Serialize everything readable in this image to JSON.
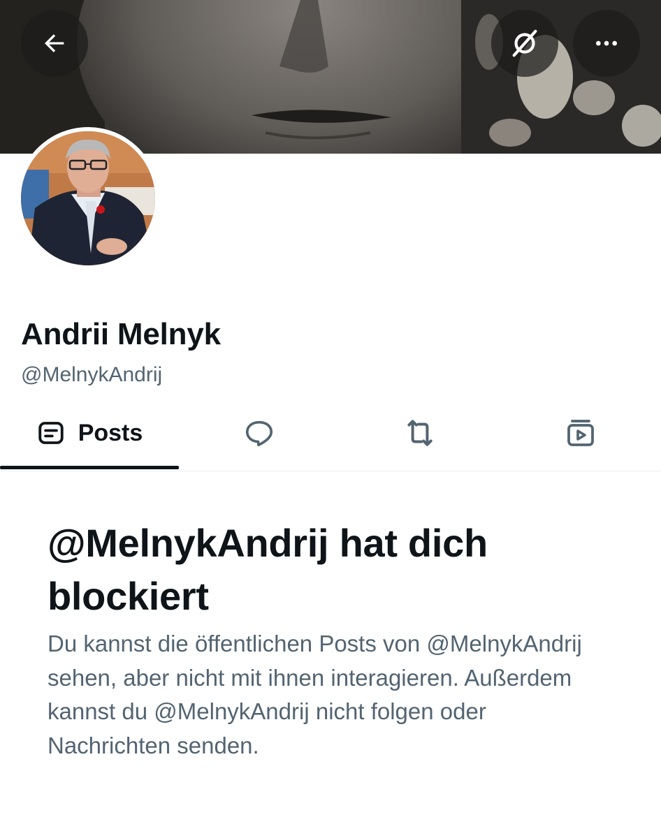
{
  "header": {
    "back_icon": "arrow-left-icon",
    "grok_icon": "grok-icon",
    "more_icon": "more-horizontal-icon"
  },
  "profile": {
    "display_name": "Andrii Melnyk",
    "handle": "@MelnykAndrij"
  },
  "tabs": [
    {
      "label": "Posts",
      "icon": "posts-icon",
      "active": true
    },
    {
      "label": "",
      "icon": "replies-icon",
      "active": false
    },
    {
      "label": "",
      "icon": "repost-icon",
      "active": false
    },
    {
      "label": "",
      "icon": "media-icon",
      "active": false
    }
  ],
  "blocked_notice": {
    "title": "@MelnykAndrij hat dich blockiert",
    "text": "Du kannst die öffentlichen Posts von @MelnykAndrij sehen, aber nicht mit ihnen interagieren. Außerdem kannst du @MelnykAndrij nicht folgen oder Nachrichten senden."
  },
  "colors": {
    "text_primary": "#0f1419",
    "text_secondary": "#536471",
    "button_overlay": "#1c1c1c"
  }
}
